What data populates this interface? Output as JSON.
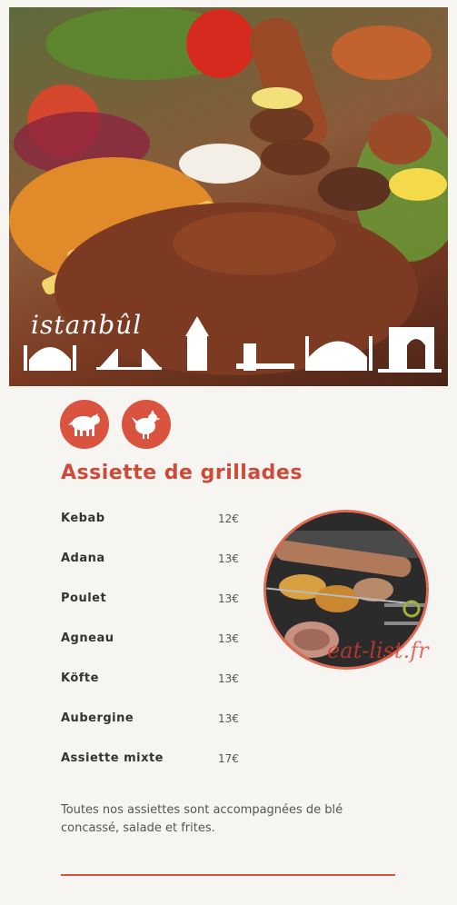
{
  "hero": {
    "brand": "istanbûl",
    "image_alt": "Mixed grill platter with kebabs, bulgur, salad and fries"
  },
  "icons": [
    {
      "name": "lamb-icon"
    },
    {
      "name": "chicken-icon"
    }
  ],
  "menu": {
    "title": "Assiette de grillades",
    "items": [
      {
        "name": "Kebab",
        "price": "12€"
      },
      {
        "name": "Adana",
        "price": "13€"
      },
      {
        "name": "Poulet",
        "price": "13€"
      },
      {
        "name": "Agneau",
        "price": "13€"
      },
      {
        "name": "Köfte",
        "price": "13€"
      },
      {
        "name": "Aubergine",
        "price": "13€"
      },
      {
        "name": "Assiette mixte",
        "price": "17€"
      }
    ],
    "note": "Toutes nos assiettes sont accompagnées de blé concassé, salade et frites."
  },
  "watermark": "eat-list.fr",
  "colors": {
    "accent": "#d9533f",
    "background": "#f7f5f2",
    "text": "#333333"
  }
}
